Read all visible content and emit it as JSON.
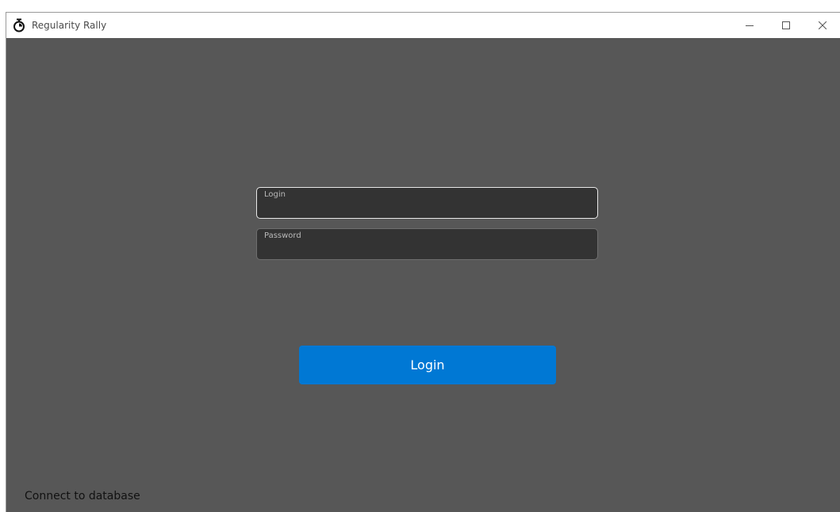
{
  "window": {
    "title": "Regularity Rally",
    "app_icon": "stopwatch-icon",
    "controls": {
      "minimize_icon": "minimize-icon",
      "maximize_icon": "maximize-icon",
      "close_icon": "close-icon"
    }
  },
  "form": {
    "login_field": {
      "label": "Login",
      "value": "",
      "focused": true
    },
    "password_field": {
      "label": "Password",
      "value": ""
    },
    "submit_label": "Login"
  },
  "footer": {
    "status": "Connect to database"
  },
  "colors": {
    "background": "#575757",
    "field_background": "#333333",
    "accent": "#0078d4"
  }
}
